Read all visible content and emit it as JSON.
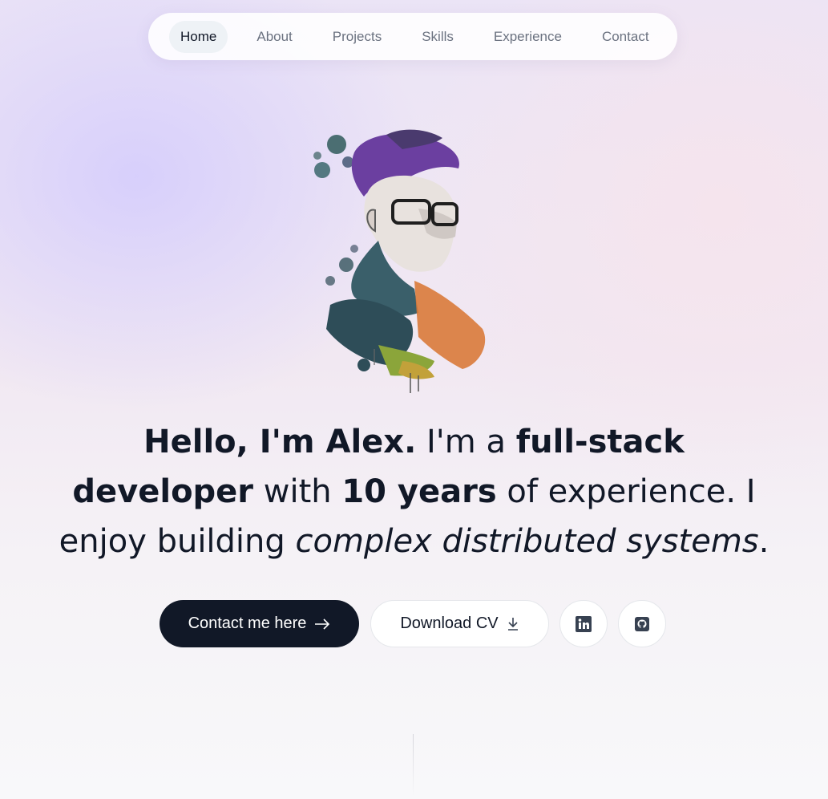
{
  "nav": {
    "items": [
      {
        "label": "Home",
        "active": true
      },
      {
        "label": "About",
        "active": false
      },
      {
        "label": "Projects",
        "active": false
      },
      {
        "label": "Skills",
        "active": false
      },
      {
        "label": "Experience",
        "active": false
      },
      {
        "label": "Contact",
        "active": false
      }
    ]
  },
  "intro": {
    "greeting": "Hello, I'm Alex.",
    "im_a": " I'm a ",
    "role": "full-stack developer",
    "with": " with ",
    "years": "10 years",
    "rest": " of experience. I enjoy building ",
    "focus": "complex distributed systems",
    "end": "."
  },
  "actions": {
    "contact_label": "Contact me here",
    "contact_icon": "arrow-right-icon",
    "cv_label": "Download CV",
    "cv_icon": "download-icon",
    "linkedin_icon": "linkedin-icon",
    "github_icon": "github-icon"
  },
  "colors": {
    "primary_button": "#111827",
    "text": "#111827",
    "muted": "#6b7280"
  }
}
